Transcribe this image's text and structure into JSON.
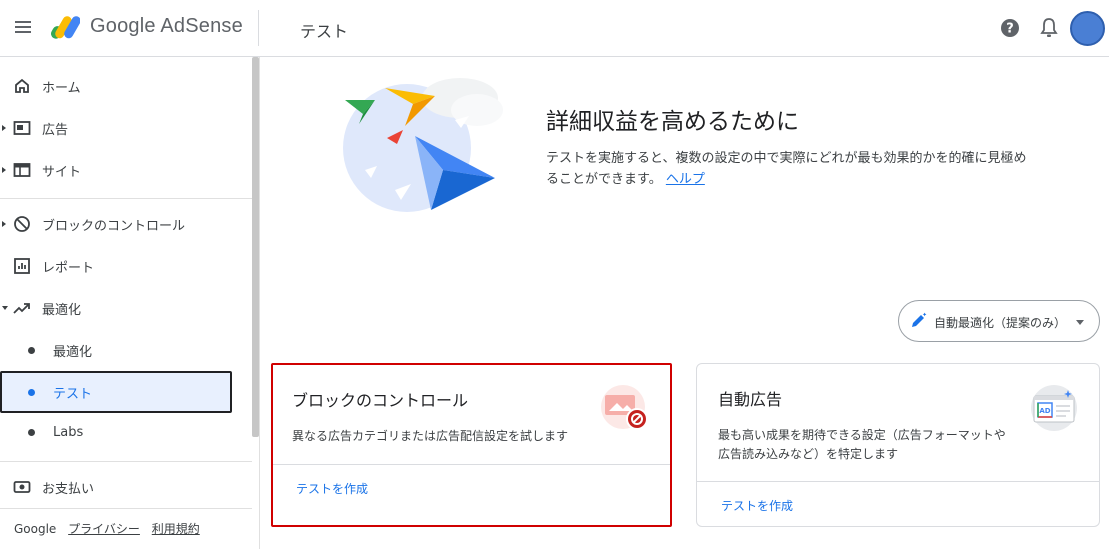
{
  "header": {
    "brand": "Google AdSense",
    "page_title": "テスト"
  },
  "sidebar": {
    "items": {
      "home": "ホーム",
      "ads": "広告",
      "sites": "サイト",
      "blocking": "ブロックのコントロール",
      "reports": "レポート",
      "optimization": "最適化",
      "optimization_sub": "最適化",
      "test": "テスト",
      "labs": "Labs",
      "payments": "お支払い"
    },
    "footer": {
      "google": "Google",
      "privacy": "プライバシー",
      "terms": "利用規約"
    }
  },
  "hero": {
    "title": "詳細収益を高めるために",
    "description": "テストを実施すると、複数の設定の中で実際にどれが最も効果的かを的確に見極めることができます。",
    "help_link": "ヘルプ"
  },
  "auto_optimize": {
    "label": "自動最適化（提案のみ）"
  },
  "cards": [
    {
      "title": "ブロックのコントロール",
      "description": "異なる広告カテゴリまたは広告配信設定を試します",
      "action": "テストを作成"
    },
    {
      "title": "自動広告",
      "description": "最も高い成果を期待できる設定（広告フォーマットや広告読み込みなど）を特定します",
      "action": "テストを作成",
      "icon_text": "AD"
    }
  ],
  "colors": {
    "accent": "#1a73e8",
    "highlight_border": "#d00000",
    "active_bg": "#e8f0fe"
  }
}
